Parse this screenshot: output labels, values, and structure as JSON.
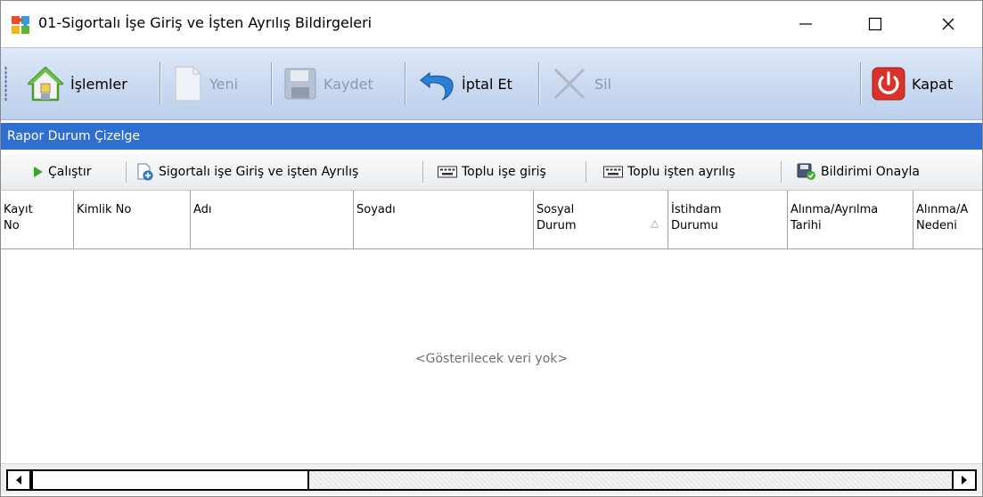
{
  "window": {
    "title": "01-Sigortalı İşe Giriş ve İşten Ayrılış Bildirgeleri",
    "controls": {
      "minimize": "—",
      "maximize": "☐",
      "close": "✕"
    }
  },
  "toolbar": {
    "items": [
      {
        "label": "İşlemler",
        "icon": "home-icon",
        "enabled": true
      },
      {
        "label": "Yeni",
        "icon": "new-document-icon",
        "enabled": false
      },
      {
        "label": "Kaydet",
        "icon": "save-icon",
        "enabled": false
      },
      {
        "label": "İptal Et",
        "icon": "undo-icon",
        "enabled": true
      },
      {
        "label": "Sil",
        "icon": "delete-x-icon",
        "enabled": false
      },
      {
        "label": "Kapat",
        "icon": "power-icon",
        "enabled": true
      }
    ]
  },
  "section": {
    "title": "Rapor Durum Çizelge"
  },
  "actions": {
    "items": [
      {
        "label": "Çalıştır",
        "icon": "play-icon"
      },
      {
        "label": "Sigortalı işe Giriş ve işten Ayrılış",
        "icon": "add-document-icon"
      },
      {
        "label": "Toplu işe giriş",
        "icon": "keyboard-icon"
      },
      {
        "label": "Toplu işten ayrılış",
        "icon": "keyboard-icon"
      },
      {
        "label": "Bildirimi Onayla",
        "icon": "approve-icon"
      }
    ]
  },
  "grid": {
    "columns": [
      {
        "line1": "Kayıt",
        "line2": "No"
      },
      {
        "line1": "Kimlik No",
        "line2": ""
      },
      {
        "line1": "Adı",
        "line2": ""
      },
      {
        "line1": "Soyadı",
        "line2": ""
      },
      {
        "line1": "Sosyal",
        "line2": "Durum",
        "sorted": "ascending"
      },
      {
        "line1": "İstihdam",
        "line2": "Durumu"
      },
      {
        "line1": "Alınma/Ayrılma",
        "line2": "Tarihi"
      },
      {
        "line1": "Alınma/A",
        "line2": "Nedeni"
      }
    ],
    "rows": [],
    "empty_message": "<Gösterilecek veri yok>"
  },
  "colors": {
    "section_header_bg": "#2e6fd0",
    "toolbar_bg": "#c9d9f0",
    "close_button_red": "#d8322a"
  }
}
